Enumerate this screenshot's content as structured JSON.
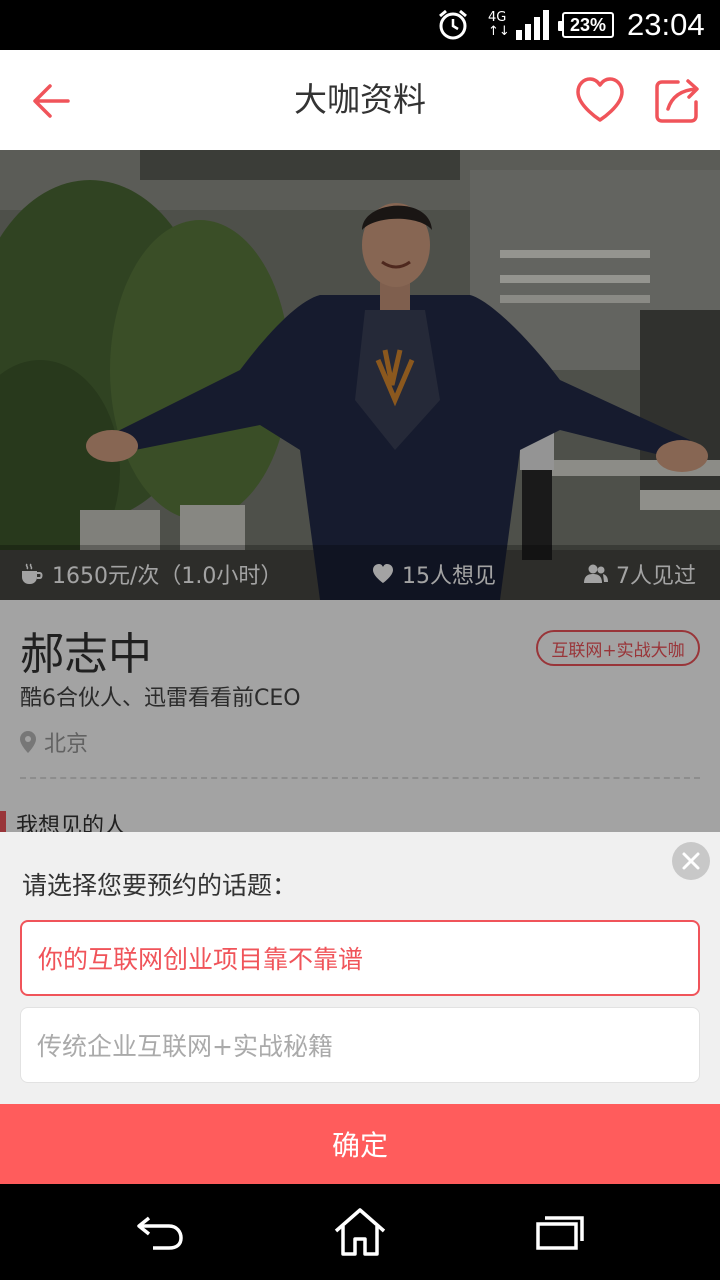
{
  "status_bar": {
    "network": "4G",
    "network_arrows": "↑↓",
    "battery": "23%",
    "time": "23:04"
  },
  "header": {
    "title": "大咖资料",
    "icons": {
      "back": "arrow-left-icon",
      "favorite": "heart-icon",
      "share": "share-icon"
    },
    "accent_color": "#f0545a"
  },
  "hero": {
    "price": "1650元/次（1.0小时）",
    "want_to_meet": "15人想见",
    "have_met": "7人见过"
  },
  "profile": {
    "name": "郝志中",
    "tag": "互联网+实战大咖",
    "subtitle": "酷6合伙人、迅雷看看前CEO",
    "location": "北京",
    "section_title": "我想见的人"
  },
  "sheet": {
    "prompt": "请选择您要预约的话题：",
    "topics": [
      {
        "label": "你的互联网创业项目靠不靠谱",
        "selected": true
      },
      {
        "label": "传统企业互联网+实战秘籍",
        "selected": false
      }
    ],
    "confirm_label": "确定",
    "confirm_color": "#ff5c5c"
  },
  "navbar": {
    "icons": [
      "back-nav-icon",
      "home-icon",
      "recent-apps-icon"
    ]
  }
}
